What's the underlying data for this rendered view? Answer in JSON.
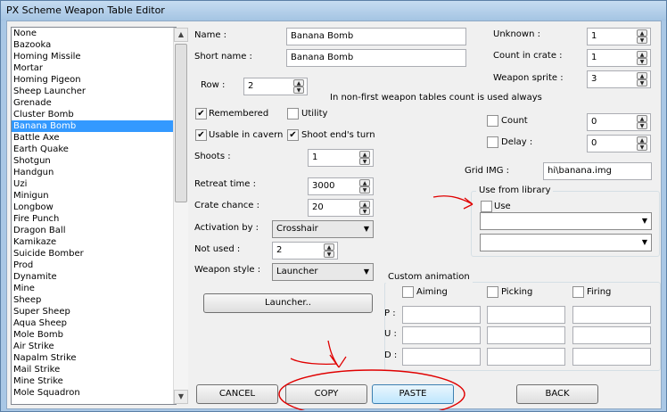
{
  "window": {
    "title": "PX Scheme Weapon Table Editor"
  },
  "weapon_list": {
    "selected": "Banana Bomb",
    "items": [
      "None",
      "Bazooka",
      "Homing Missile",
      "Mortar",
      "Homing Pigeon",
      "Sheep Launcher",
      "Grenade",
      "Cluster Bomb",
      "Banana Bomb",
      "Battle Axe",
      "Earth Quake",
      "Shotgun",
      "Handgun",
      "Uzi",
      "Minigun",
      "Longbow",
      "Fire Punch",
      "Dragon Ball",
      "Kamikaze",
      "Suicide Bomber",
      "Prod",
      "Dynamite",
      "Mine",
      "Sheep",
      "Super Sheep",
      "Aqua Sheep",
      "Mole Bomb",
      "Air Strike",
      "Napalm Strike",
      "Mail Strike",
      "Mine Strike",
      "Mole Squadron"
    ]
  },
  "fields": {
    "name_label": "Name :",
    "name_value": "Banana Bomb",
    "short_label": "Short name :",
    "short_value": "Banana Bomb",
    "row_label": "Row :",
    "row_value": "2",
    "note": "In non-first weapon tables count is used always",
    "unknown_label": "Unknown :",
    "unknown_value": "1",
    "crate_count_label": "Count in crate :",
    "crate_count_value": "1",
    "sprite_label": "Weapon sprite :",
    "sprite_value": "3",
    "remembered": "Remembered",
    "utility": "Utility",
    "usable_cavern": "Usable in cavern",
    "shoot_end": "Shoot end's turn",
    "count_label": "Count",
    "count_value": "0",
    "delay_label": "Delay :",
    "delay_value": "0",
    "shoots_label": "Shoots :",
    "shoots_value": "1",
    "grid_label": "Grid IMG :",
    "grid_value": "hi\\banana.img",
    "retreat_label": "Retreat time :",
    "retreat_value": "3000",
    "crate_chance_label": "Crate chance :",
    "crate_chance_value": "20",
    "activation_label": "Activation by :",
    "activation_value": "Crosshair",
    "not_used_label": "Not used :",
    "not_used_value": "2",
    "style_label": "Weapon style :",
    "style_value": "Launcher",
    "launcher_button": "Launcher.."
  },
  "library": {
    "title": "Use from library",
    "use_label": "Use"
  },
  "custom_animation": {
    "title": "Custom animation",
    "aiming": "Aiming",
    "picking": "Picking",
    "firing": "Firing",
    "p_label": "P :",
    "u_label": "U :",
    "d_label": "D :"
  },
  "buttons": {
    "cancel": "CANCEL",
    "copy": "COPY",
    "paste": "PASTE",
    "back": "BACK"
  },
  "checks": {
    "remembered": true,
    "utility": false,
    "usable_cavern": true,
    "shoot_end": true,
    "count": false,
    "delay": false,
    "use": false,
    "aiming": false,
    "picking": false,
    "firing": false
  }
}
